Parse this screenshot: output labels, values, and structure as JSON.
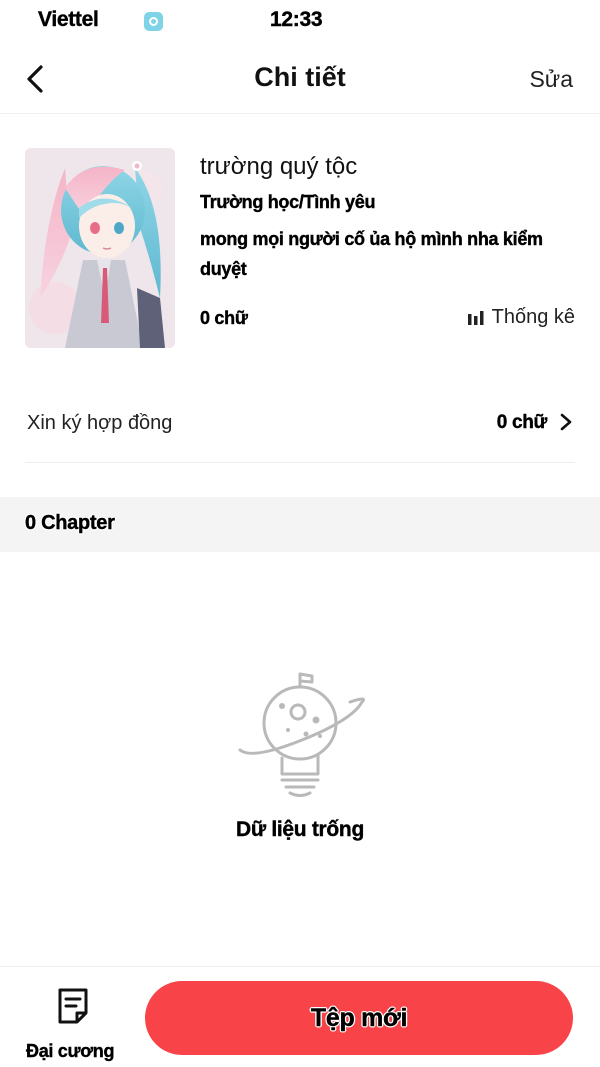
{
  "status_bar": {
    "carrier": "Viettel",
    "time": "12:33",
    "app_icon": "cloud-app-icon"
  },
  "nav": {
    "title": "Chi tiết",
    "edit_label": "Sửa",
    "back_icon": "chevron-left-icon"
  },
  "book": {
    "title": "trường quý tộc",
    "genre": "Trường học/Tình yêu",
    "description": "mong mọi người cố ủa hộ mình nha kiểm duyệt",
    "word_count": "0 chữ",
    "stats_label": "Thống kê",
    "cover": "anime-girl-cover-image"
  },
  "contract": {
    "label": "Xin ký hợp đồng",
    "word_count": "0 chữ"
  },
  "chapters": {
    "count_label": "0 Chapter",
    "empty_text": "Dữ liệu trống"
  },
  "bottom": {
    "outline_label": "Đại cương",
    "new_file_label": "Tệp mới"
  },
  "colors": {
    "accent": "#f84349",
    "section_bg": "#f4f4f4",
    "hair_pink": "#f2a9c0",
    "hair_cyan": "#7fcfe0"
  }
}
